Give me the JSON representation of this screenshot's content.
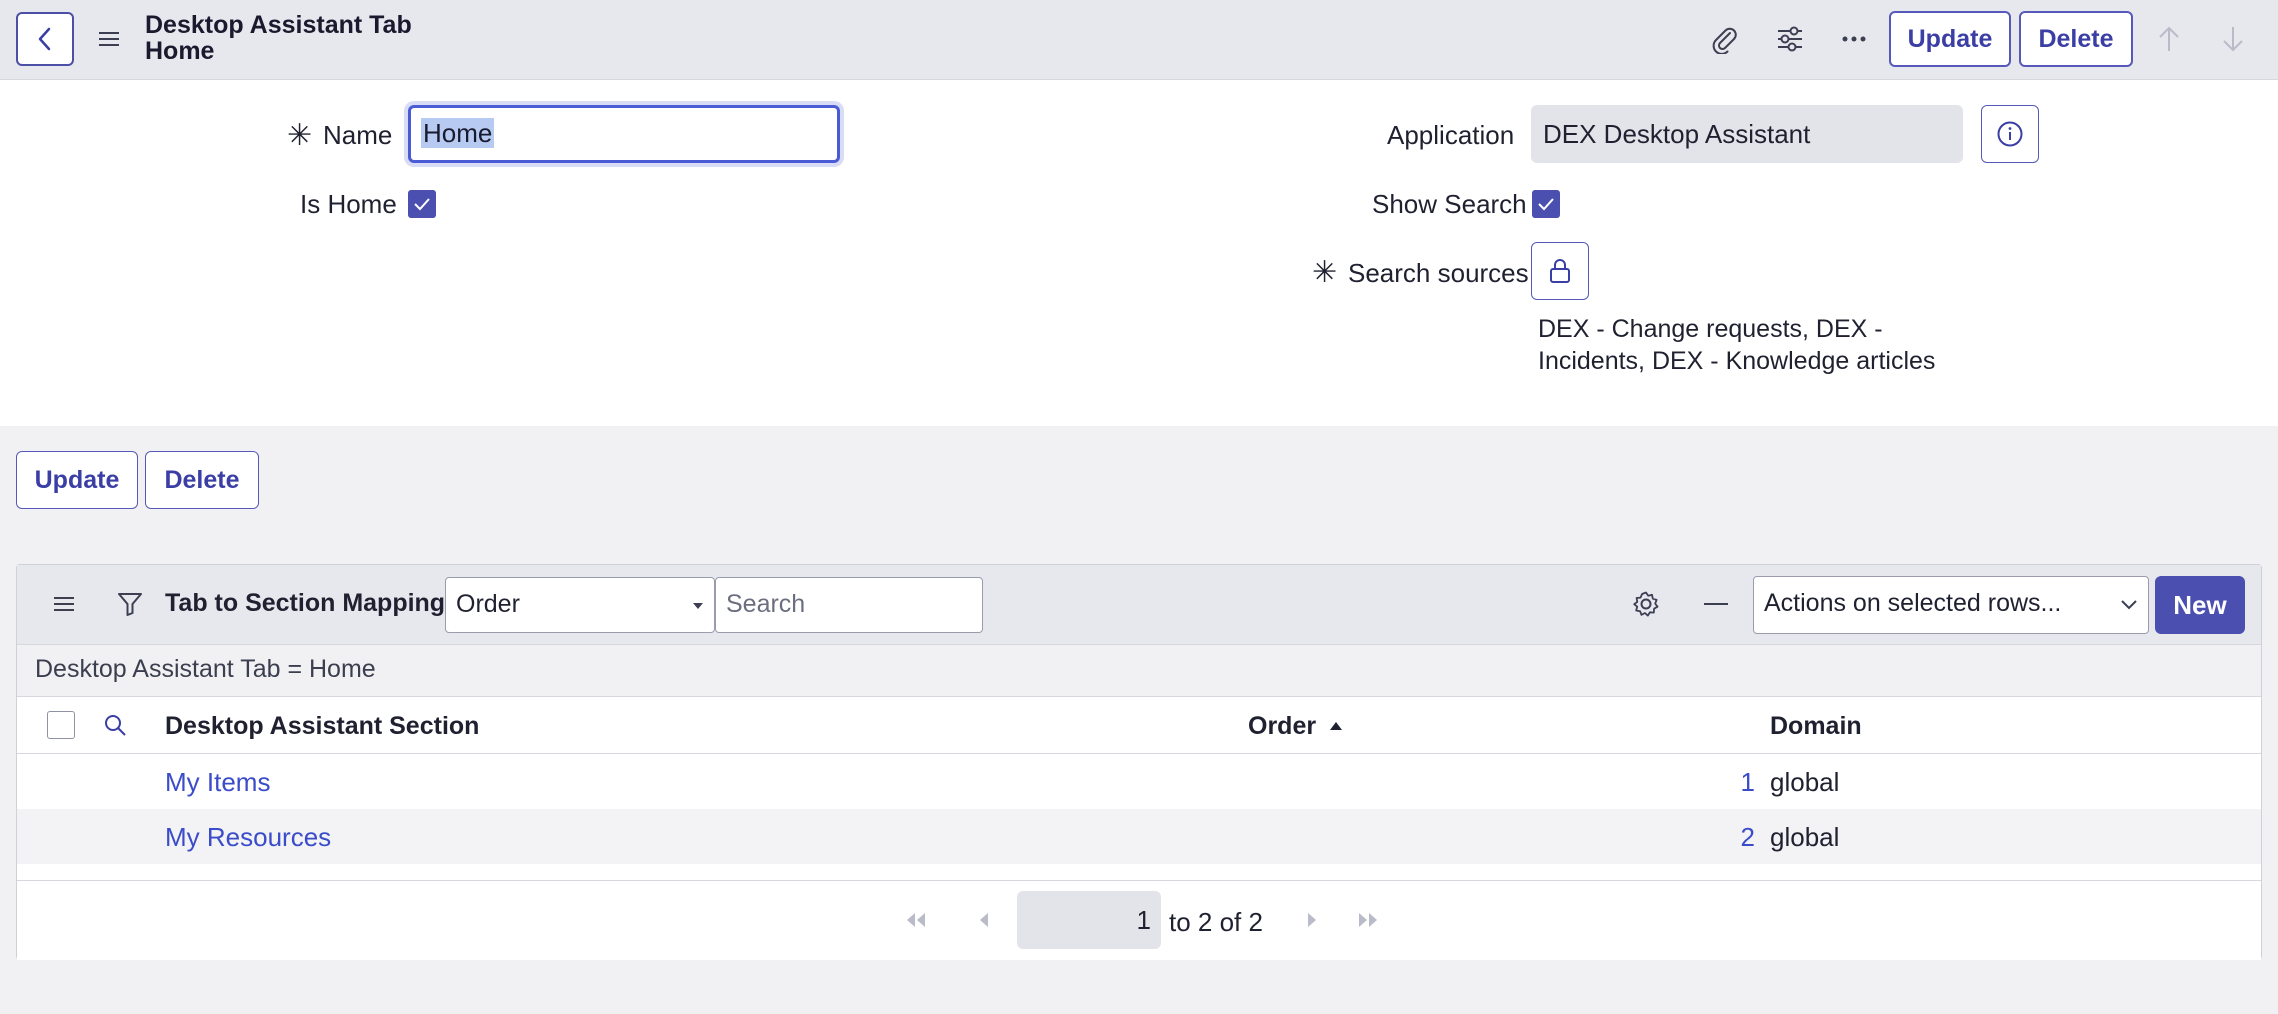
{
  "header": {
    "title": "Desktop Assistant Tab Home",
    "update_label": "Update",
    "delete_label": "Delete"
  },
  "form": {
    "name_label": "Name",
    "name_value": "Home",
    "is_home_label": "Is Home",
    "is_home_checked": true,
    "application_label": "Application",
    "application_value": "DEX Desktop Assistant",
    "show_search_label": "Show Search",
    "show_search_checked": true,
    "search_sources_label": "Search sources",
    "search_sources_value": "DEX - Change requests, DEX - Incidents, DEX - Knowledge articles"
  },
  "form_buttons": {
    "update_label": "Update",
    "delete_label": "Delete"
  },
  "related_list": {
    "title": "Tab to Section Mappings",
    "search_field_select": "Order",
    "search_placeholder": "Search",
    "actions_select": "Actions on selected rows...",
    "new_label": "New",
    "filter_text": "Desktop Assistant Tab = Home",
    "columns": [
      "Desktop Assistant Section",
      "Order",
      "Domain"
    ],
    "rows": [
      {
        "section": "My Items",
        "order": "1",
        "domain": "global"
      },
      {
        "section": "My Resources",
        "order": "2",
        "domain": "global"
      }
    ],
    "pager": {
      "current_page": "1",
      "range_text": "to 2 of 2"
    }
  },
  "colors": {
    "accent": "#4a4fb0",
    "link": "#3a4cc9",
    "header_bg": "#e7e8ee"
  }
}
